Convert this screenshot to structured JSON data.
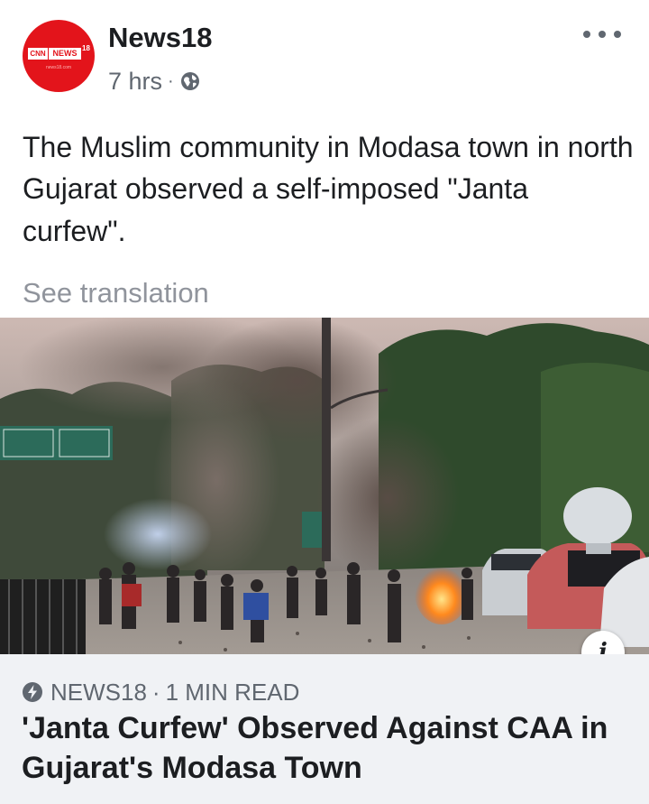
{
  "post": {
    "page_name": "News18",
    "avatar": {
      "brand_left": "CNN",
      "brand_right": "NEWS",
      "brand_number": "18",
      "url": "news18.com"
    },
    "time": "7 hrs",
    "separator": "·",
    "privacy_icon": "globe-icon",
    "more_icon": "more-options-icon",
    "text": "The Muslim community in Modasa town in north Gujarat observed a self-imposed \"Janta curfew\".",
    "see_translation": "See translation"
  },
  "media": {
    "sign_text": "",
    "info_label": "i"
  },
  "link": {
    "source": "NEWS18",
    "separator": "·",
    "read_time": "1 MIN READ",
    "title": "'Janta Curfew' Observed Against CAA in Gujarat's Modasa Town",
    "icon": "instant-article-bolt-icon"
  },
  "colors": {
    "brand_red": "#e3141b",
    "text_primary": "#1c1e21",
    "text_secondary": "#606770",
    "text_muted": "#90949c",
    "card_bg": "#f0f2f5"
  }
}
